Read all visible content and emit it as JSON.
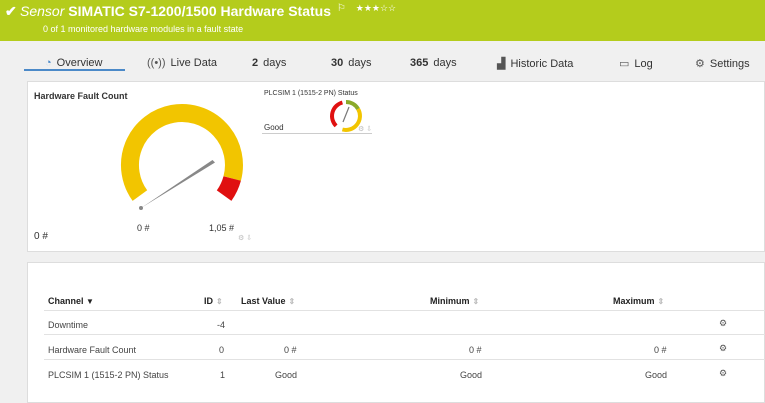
{
  "header": {
    "check_icon": "check-icon",
    "sensor_word": "Sensor",
    "sensor_name": "SIMATIC S7-1200/1500 Hardware Status",
    "flag_icon": "flag-icon",
    "stars": "★★★☆☆",
    "subtitle": "0 of 1 monitored hardware modules in a fault state"
  },
  "tabs": [
    {
      "label": "Overview",
      "icon": "gauge-icon"
    },
    {
      "label": "Live Data",
      "icon": "live-data-icon"
    },
    {
      "num": "2",
      "label": "days"
    },
    {
      "num": "30",
      "label": "days"
    },
    {
      "num": "365",
      "label": "days"
    },
    {
      "label": "Historic Data",
      "icon": "chart-icon"
    },
    {
      "label": "Log",
      "icon": "log-icon"
    },
    {
      "label": "Settings",
      "icon": "gear-icon"
    }
  ],
  "gauge": {
    "title": "Hardware Fault Count",
    "value": 0,
    "min_label": "0 #",
    "max_label": "1,05 #",
    "value_label": "0 #",
    "max": 1.05,
    "colors": {
      "main": "#f2c500",
      "alert": "#e01010",
      "needle": "#888888"
    }
  },
  "status_gauge": {
    "title": "PLCSIM 1 (1515-2 PN) Status",
    "value": "Good",
    "colors": [
      "#8aaa2a",
      "#f2c500",
      "#e01010"
    ]
  },
  "table": {
    "headers": {
      "channel": "Channel",
      "id": "ID",
      "last_value": "Last Value",
      "minimum": "Minimum",
      "maximum": "Maximum"
    },
    "rows": [
      {
        "channel": "Downtime",
        "id": "-4",
        "last_value": "",
        "minimum": "",
        "maximum": ""
      },
      {
        "channel": "Hardware Fault Count",
        "id": "0",
        "last_value": "0 #",
        "minimum": "0 #",
        "maximum": "0 #"
      },
      {
        "channel": "PLCSIM 1 (1515-2 PN) Status",
        "id": "1",
        "last_value": "Good",
        "minimum": "Good",
        "maximum": "Good"
      }
    ]
  }
}
